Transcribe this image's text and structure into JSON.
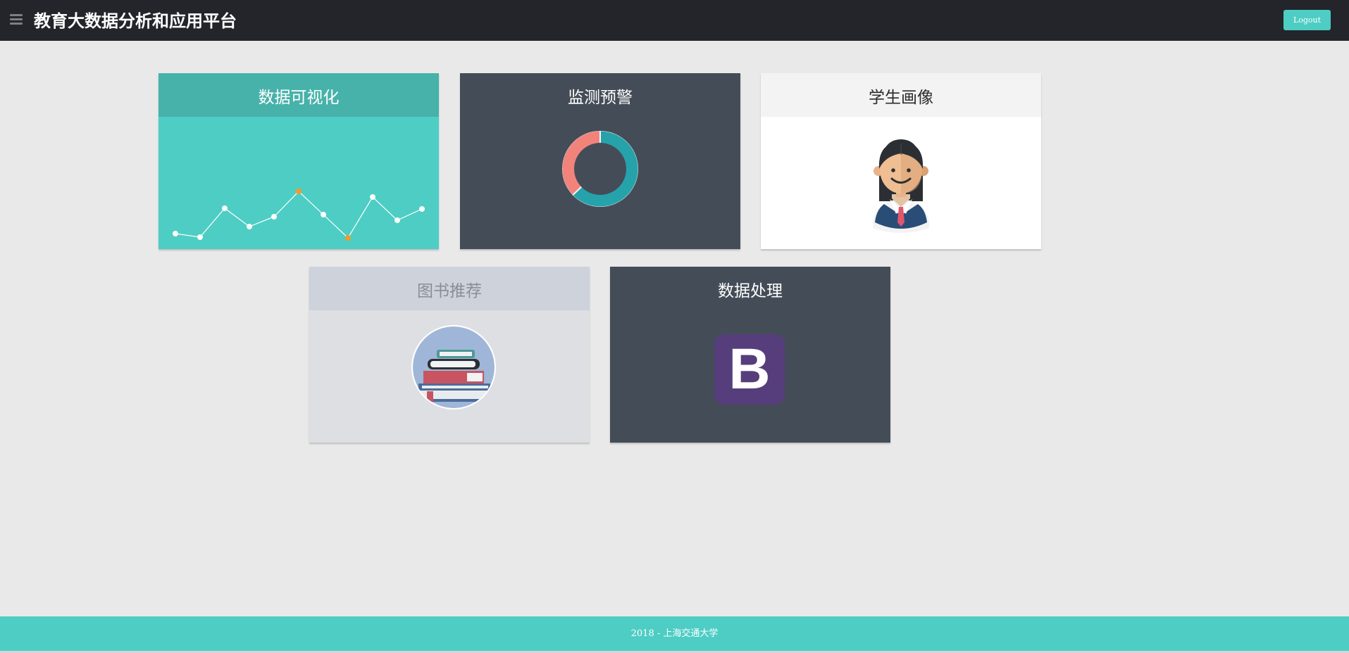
{
  "header": {
    "title": "教育大数据分析和应用平台",
    "logout_label": "Logout",
    "menu_icon": "hamburger-menu-icon"
  },
  "cards": [
    {
      "title": "数据可视化",
      "icon": "line-chart-icon"
    },
    {
      "title": "监测预警",
      "icon": "donut-chart-icon"
    },
    {
      "title": "学生画像",
      "icon": "student-avatar-icon"
    },
    {
      "title": "图书推荐",
      "icon": "book-stack-icon"
    },
    {
      "title": "数据处理",
      "icon": "bootstrap-logo-icon",
      "logo_letter": "B"
    }
  ],
  "footer": {
    "text": "2018 - 上海交通大学"
  },
  "colors": {
    "topbar": "#23252b",
    "accent": "#4ecdc4",
    "dark_card": "#444c57",
    "donut_teal": "#26a2ab",
    "donut_salmon": "#f2837b",
    "line_highlight": "#f59a23",
    "bootstrap_purple": "#563d7c"
  }
}
